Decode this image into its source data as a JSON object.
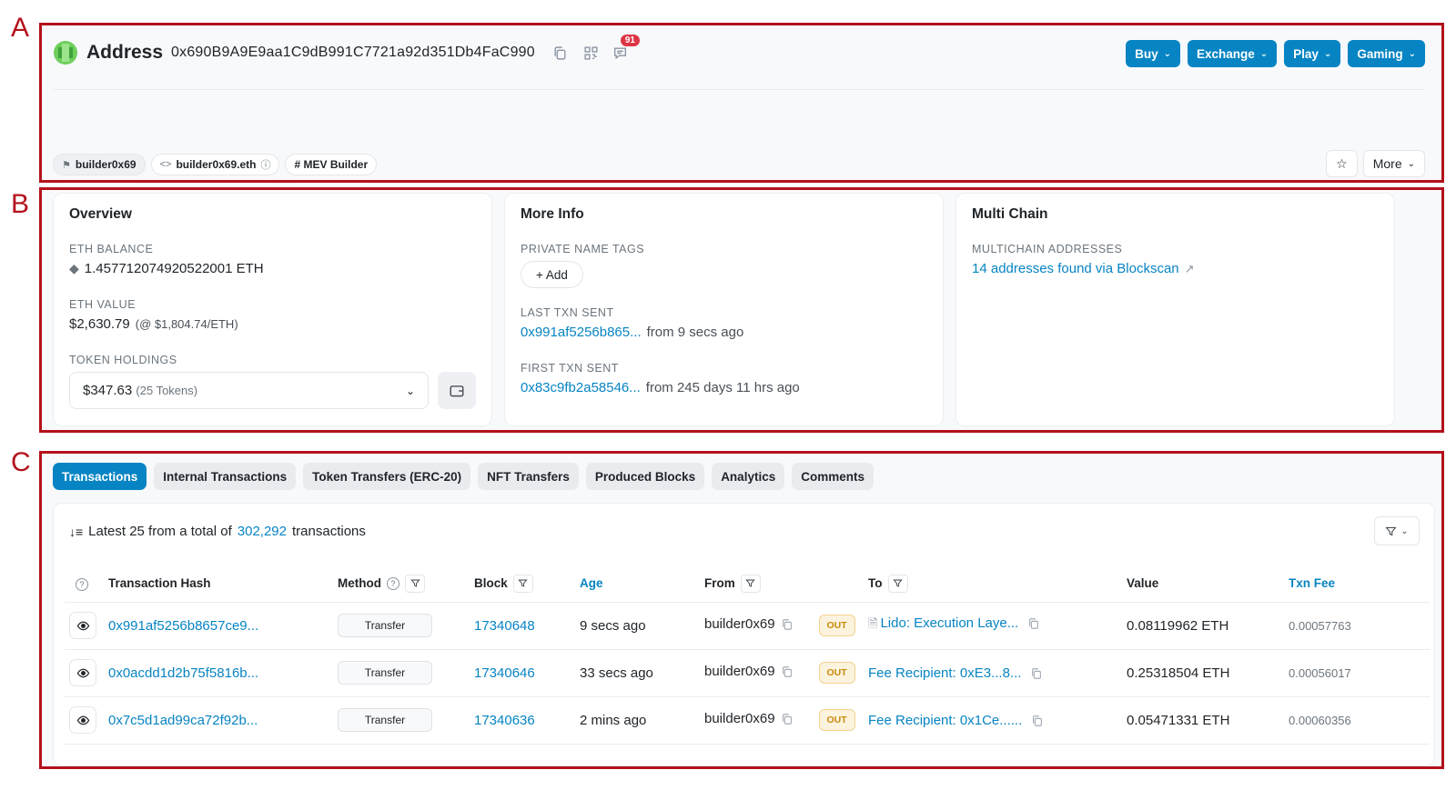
{
  "regions": {
    "a": "A",
    "b": "B",
    "c": "C"
  },
  "header": {
    "label": "Address",
    "address": "0x690B9A9E9aa1C9dB991C7721a92d351Db4FaC990",
    "comment_count": "91",
    "buttons": [
      "Buy",
      "Exchange",
      "Play",
      "Gaming"
    ],
    "tags": [
      "builder0x69",
      "builder0x69.eth",
      "# MEV Builder"
    ],
    "more_label": "More"
  },
  "overview": {
    "title": "Overview",
    "eth_balance_label": "ETH BALANCE",
    "eth_balance": "1.457712074920522001 ETH",
    "eth_value_label": "ETH VALUE",
    "eth_value": "$2,630.79",
    "eth_price": "(@ $1,804.74/ETH)",
    "token_label": "TOKEN HOLDINGS",
    "token_value": "$347.63",
    "token_count": "(25 Tokens)"
  },
  "more_info": {
    "title": "More Info",
    "private_tags_label": "PRIVATE NAME TAGS",
    "add_label": "+ Add",
    "last_txn_label": "LAST TXN SENT",
    "last_txn_hash": "0x991af5256b865...",
    "last_txn_time": "from 9 secs ago",
    "first_txn_label": "FIRST TXN SENT",
    "first_txn_hash": "0x83c9fb2a58546...",
    "first_txn_time": "from 245 days 11 hrs ago"
  },
  "multi_chain": {
    "title": "Multi Chain",
    "label": "MULTICHAIN ADDRESSES",
    "link": "14 addresses found via Blockscan"
  },
  "tabs": [
    "Transactions",
    "Internal Transactions",
    "Token Transfers (ERC-20)",
    "NFT Transfers",
    "Produced Blocks",
    "Analytics",
    "Comments"
  ],
  "summary": {
    "prefix": "Latest 25 from a total of",
    "total": "302,292",
    "suffix": "transactions"
  },
  "columns": {
    "hash": "Transaction Hash",
    "method": "Method",
    "block": "Block",
    "age": "Age",
    "from": "From",
    "to": "To",
    "value": "Value",
    "fee": "Txn Fee"
  },
  "rows": [
    {
      "hash": "0x991af5256b8657ce9...",
      "method": "Transfer",
      "block": "17340648",
      "age": "9 secs ago",
      "from": "builder0x69",
      "dir": "OUT",
      "to": "Lido: Execution Laye...",
      "value": "0.08119962 ETH",
      "fee": "0.00057763"
    },
    {
      "hash": "0x0acdd1d2b75f5816b...",
      "method": "Transfer",
      "block": "17340646",
      "age": "33 secs ago",
      "from": "builder0x69",
      "dir": "OUT",
      "to": "Fee Recipient: 0xE3...8...",
      "value": "0.25318504 ETH",
      "fee": "0.00056017"
    },
    {
      "hash": "0x7c5d1ad99ca72f92b...",
      "method": "Transfer",
      "block": "17340636",
      "age": "2 mins ago",
      "from": "builder0x69",
      "dir": "OUT",
      "to": "Fee Recipient: 0x1Ce......",
      "value": "0.05471331 ETH",
      "fee": "0.00060356"
    }
  ]
}
